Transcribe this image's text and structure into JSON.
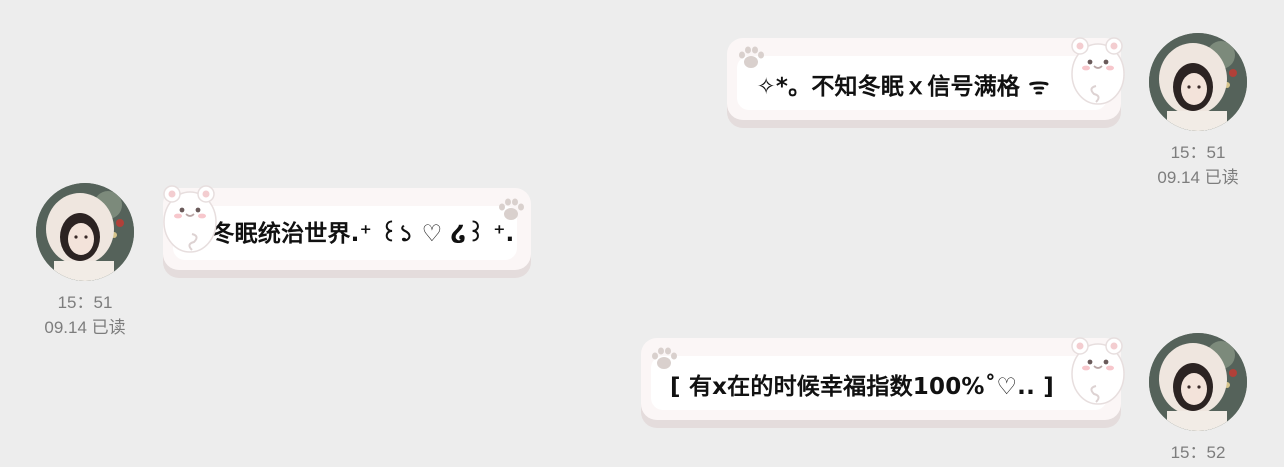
{
  "messages": [
    {
      "side": "right",
      "text": "✧*。不知冬眠ｘ信号满格 ᯤ",
      "time": "15：51",
      "date_read": "09.14 已读"
    },
    {
      "side": "left",
      "text": "冬眠统治世界.⁺ ꒰১ ♡ ໒꒱ ⁺.",
      "time": "15：51",
      "date_read": "09.14 已读"
    },
    {
      "side": "right",
      "text": "[ 有x在的时候幸福指数100%˚♡.. ]",
      "time": "15：52"
    }
  ],
  "icons": {
    "bear": "white-bear-sticker-icon",
    "paw": "paw-print-icon",
    "avatar": "user-avatar-photo"
  },
  "colors": {
    "background": "#ededed",
    "bubble": "#ffffff",
    "bubble_border": "#f4ecec",
    "text": "#111111",
    "meta": "#7d7d7d"
  }
}
